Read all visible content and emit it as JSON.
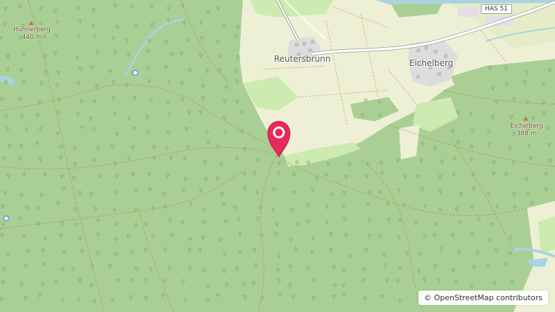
{
  "map": {
    "places": {
      "reutersbrunn": "Reutersbrunn",
      "eichelberg": "Eichelberg"
    },
    "peaks": {
      "huhnerberg": {
        "name": "Hühnerberg",
        "elevation": "440 m"
      },
      "eichelberg": {
        "name": "Eichelberg",
        "elevation": "388 m"
      }
    },
    "road_shield": "HAS 51",
    "marker": {
      "color": "#e8295b"
    },
    "attribution": {
      "symbol": "©",
      "text": "OpenStreetMap contributors"
    }
  },
  "colors": {
    "forest": "#a9cf95",
    "farmland": "#eef0d5",
    "meadow": "#cdebb0",
    "residential": "#dddddd",
    "water": "#aad3df",
    "road": "#ffffff",
    "track": "#b58a3c"
  }
}
